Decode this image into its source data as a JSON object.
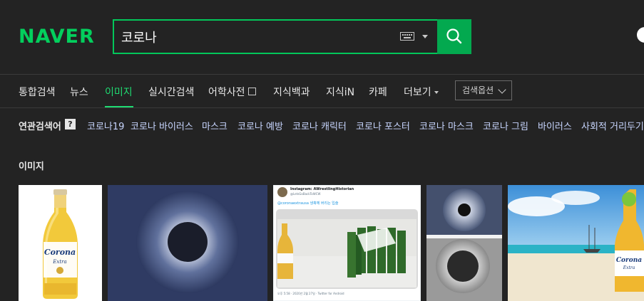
{
  "header": {
    "logo": "NAVER",
    "search_value": "코로나",
    "colors": {
      "brand": "#03c75a",
      "background": "#232323"
    }
  },
  "nav": {
    "items": [
      {
        "label": "통합검색"
      },
      {
        "label": "뉴스"
      },
      {
        "label": "이미지",
        "active": true
      },
      {
        "label": "실시간검색"
      },
      {
        "label": "어학사전"
      },
      {
        "label": "지식백과"
      },
      {
        "label": "지식iN"
      },
      {
        "label": "카페"
      },
      {
        "label": "더보기"
      }
    ],
    "options_label": "검색옵션"
  },
  "related": {
    "title": "연관검색어",
    "help": "?",
    "items": [
      "코로나19",
      "코로나 바이러스",
      "마스크",
      "코로나 예방",
      "코로나 캐릭터",
      "코로나 포스터",
      "코로나 마스크",
      "코로나 그림",
      "바이러스",
      "사회적 거리두기"
    ]
  },
  "section": {
    "title": "이미지"
  },
  "tweet": {
    "name": "Instagram: AWrestlingHistorian",
    "handle": "@LetsGoBackToWCW",
    "text": "@coronaextrausa 냉혹께 버리는 입술",
    "footer": "오후 5:58 · 2020년 2월 27일 · Twitter for Android"
  },
  "thumbnails": [
    {
      "name": "corona-bottle"
    },
    {
      "name": "solar-eclipse"
    },
    {
      "name": "tweet-screenshot"
    },
    {
      "name": "eclipse-pair"
    },
    {
      "name": "beach-corona"
    }
  ]
}
